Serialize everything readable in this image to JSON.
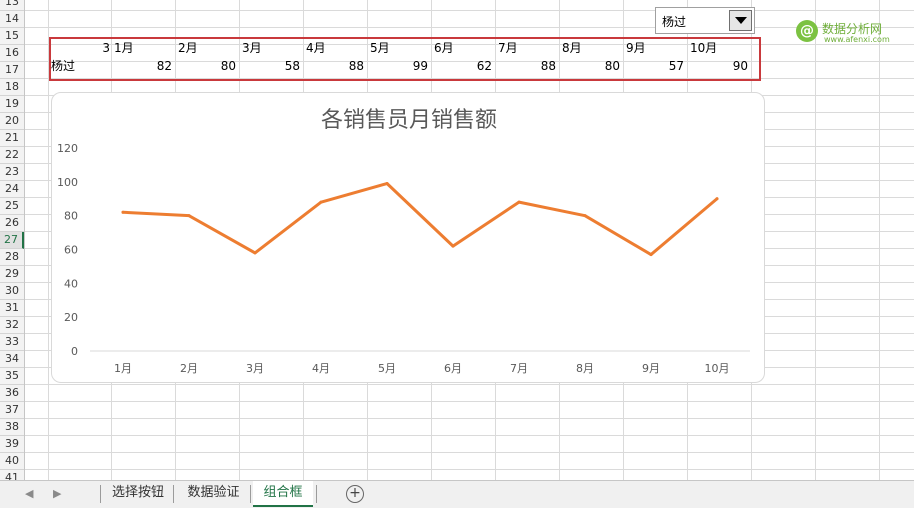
{
  "row_numbers": [
    "13",
    "14",
    "15",
    "16",
    "17",
    "18",
    "19",
    "20",
    "21",
    "22",
    "23",
    "24",
    "25",
    "26",
    "27",
    "28",
    "29",
    "30",
    "31",
    "32",
    "33",
    "34",
    "35",
    "36",
    "37",
    "38",
    "39",
    "40",
    "41"
  ],
  "selected_row": "27",
  "table": {
    "index_value": "3",
    "months": [
      "1月",
      "2月",
      "3月",
      "4月",
      "5月",
      "6月",
      "7月",
      "8月",
      "9月",
      "10月"
    ],
    "person": "杨过",
    "sales": [
      "82",
      "80",
      "58",
      "88",
      "99",
      "62",
      "88",
      "80",
      "57",
      "90"
    ]
  },
  "combobox": {
    "selected": "杨过"
  },
  "watermark": {
    "main": "数据分析网",
    "sub": "www.afenxi.com",
    "badge": "@"
  },
  "chart_data": {
    "type": "line",
    "title": "各销售员月销售额",
    "categories": [
      "1月",
      "2月",
      "3月",
      "4月",
      "5月",
      "6月",
      "7月",
      "8月",
      "9月",
      "10月"
    ],
    "series": [
      {
        "values": [
          82,
          80,
          58,
          88,
          99,
          62,
          88,
          80,
          57,
          90
        ],
        "color": "#ed7d31"
      }
    ],
    "y_ticks": [
      "0",
      "20",
      "40",
      "60",
      "80",
      "100",
      "120"
    ],
    "ylim": [
      0,
      120
    ],
    "grid": false,
    "legend": "none"
  },
  "sheet_tabs": [
    "选择按钮",
    "数据验证",
    "组合框"
  ],
  "active_tab": "组合框",
  "colors": {
    "accent": "#217346",
    "line": "#ed7d31",
    "highlight_box": "#c9393c"
  }
}
